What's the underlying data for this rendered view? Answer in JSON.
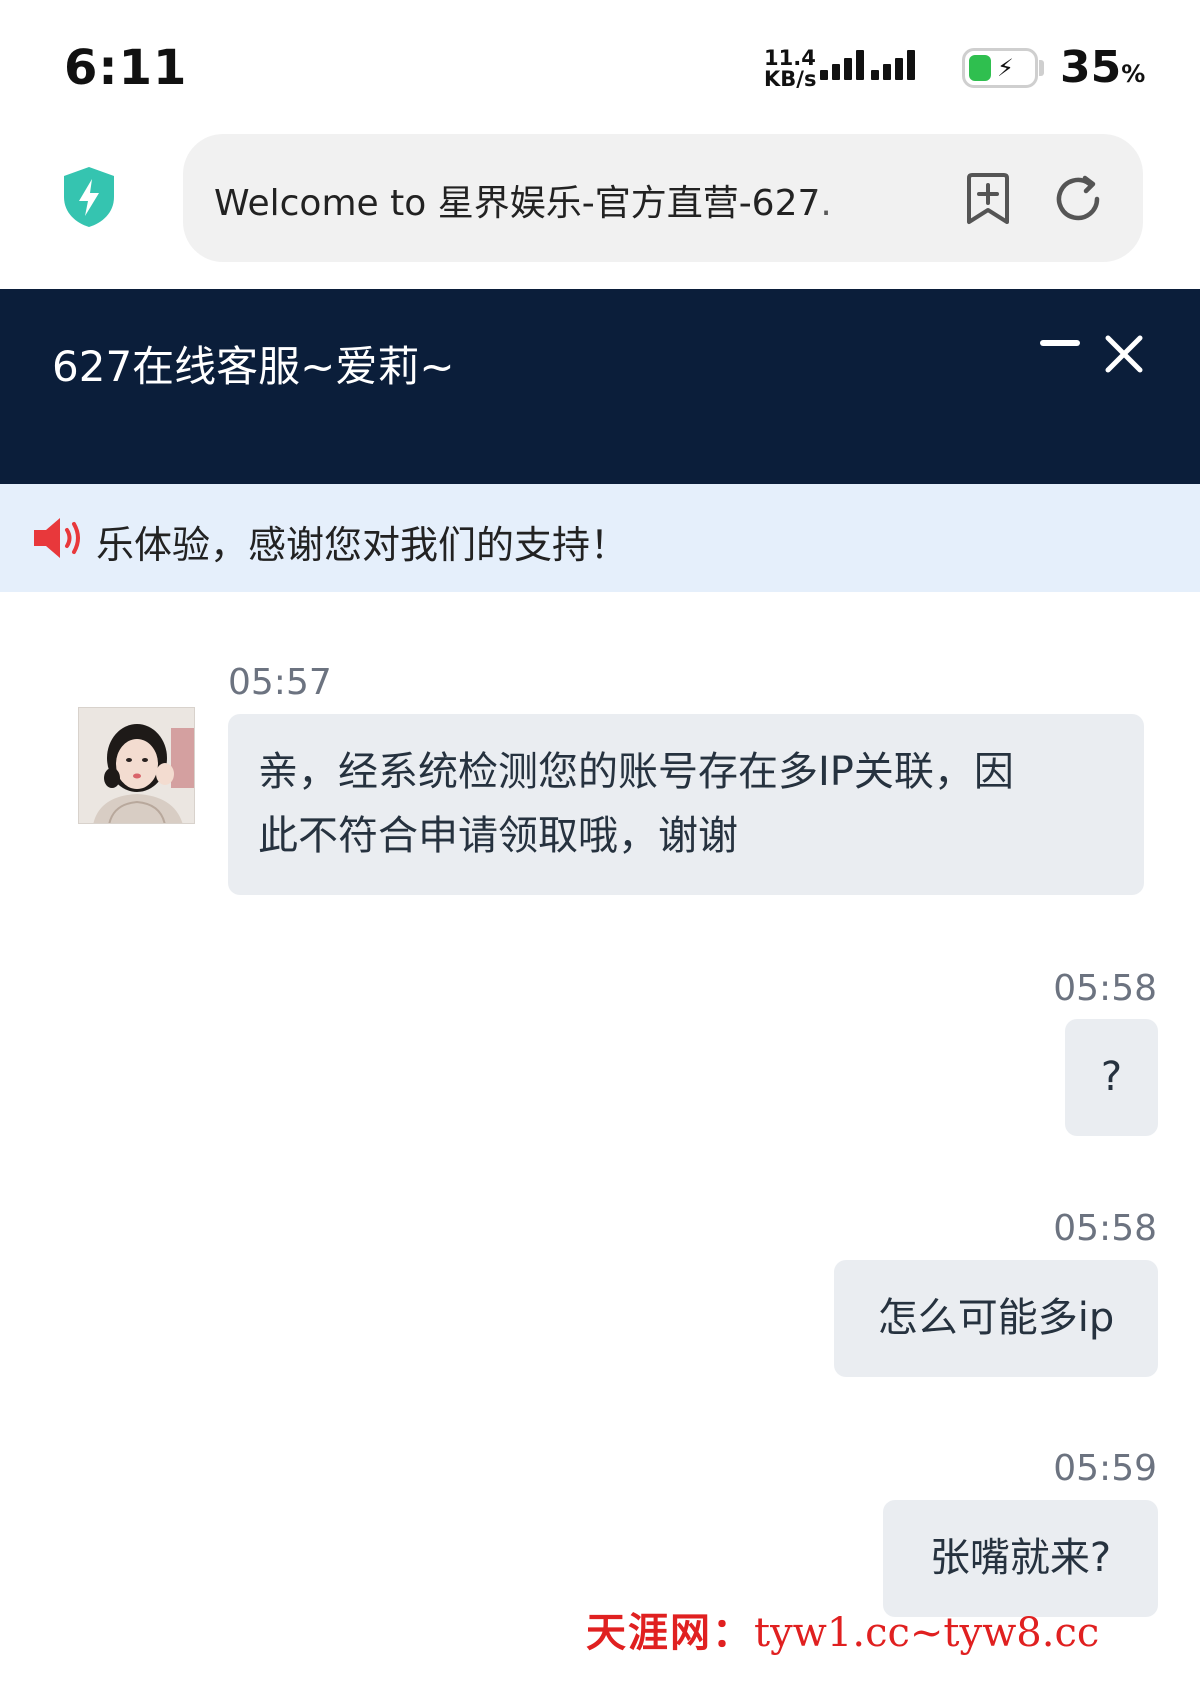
{
  "status": {
    "time": "6:11",
    "net_speed_value": "11.4",
    "net_speed_unit": "KB/s",
    "battery_pct": "35",
    "battery_unit": "%",
    "battery_level": 0.35,
    "battery_color": "#2fbf4f"
  },
  "browser": {
    "url_text": "Welcome to 星界娱乐-官方直营-627.",
    "shield_color": "#35c4b0"
  },
  "chat": {
    "title": "627在线客服~爱莉~",
    "notice": "乐体验，感谢您对我们的支持！",
    "header_color": "#0b1e3a",
    "messages": [
      {
        "time": "05:57",
        "text_line1": "亲，经系统检测您的账号存在多IP关联，因",
        "text_line2": "此不符合申请领取哦，谢谢",
        "from": "agent"
      },
      {
        "time": "05:58",
        "text": "?",
        "from": "user"
      },
      {
        "time": "05:58",
        "text": "怎么可能多ip",
        "from": "user"
      },
      {
        "time": "05:59",
        "text": "张嘴就来?",
        "from": "user"
      }
    ]
  },
  "watermark": {
    "name": "天涯网：",
    "url": "tyw1.cc~tyw8.cc"
  }
}
